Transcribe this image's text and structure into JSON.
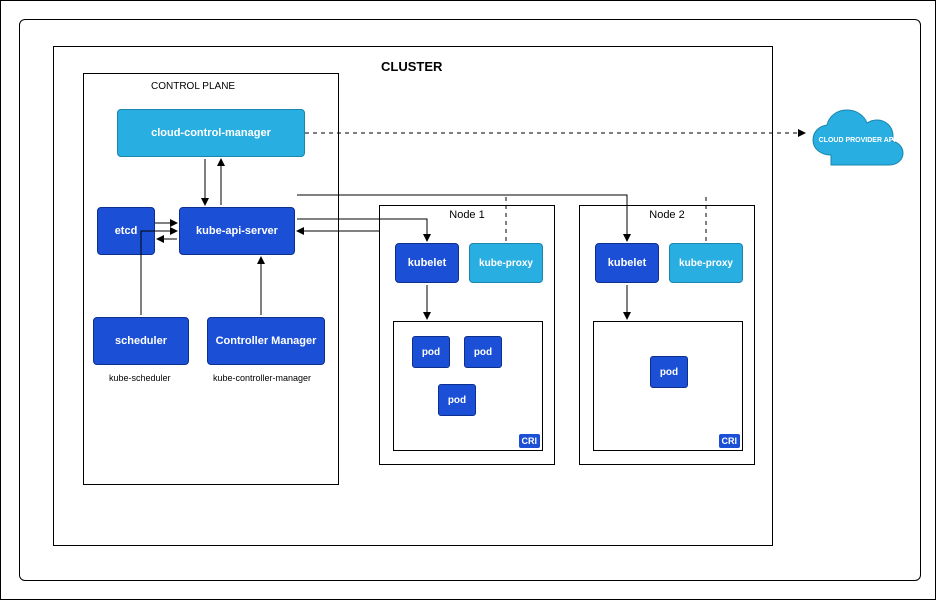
{
  "diagram": {
    "cluster_title": "CLUSTER",
    "control_plane_label": "CONTROL PLANE",
    "components": {
      "ccm": "cloud-control-manager",
      "etcd": "etcd",
      "api": "kube-api-server",
      "scheduler": "scheduler",
      "controller_manager": "Controller Manager",
      "kube_scheduler_caption": "kube-scheduler",
      "kube_controller_caption": "kube-controller-manager",
      "kubelet": "kubelet",
      "kube_proxy": "kube-proxy",
      "pod": "pod",
      "cri": "CRI"
    },
    "nodes": {
      "n1": "Node 1",
      "n2": "Node 2"
    },
    "cloud_api": "CLOUD PROVIDER API"
  }
}
